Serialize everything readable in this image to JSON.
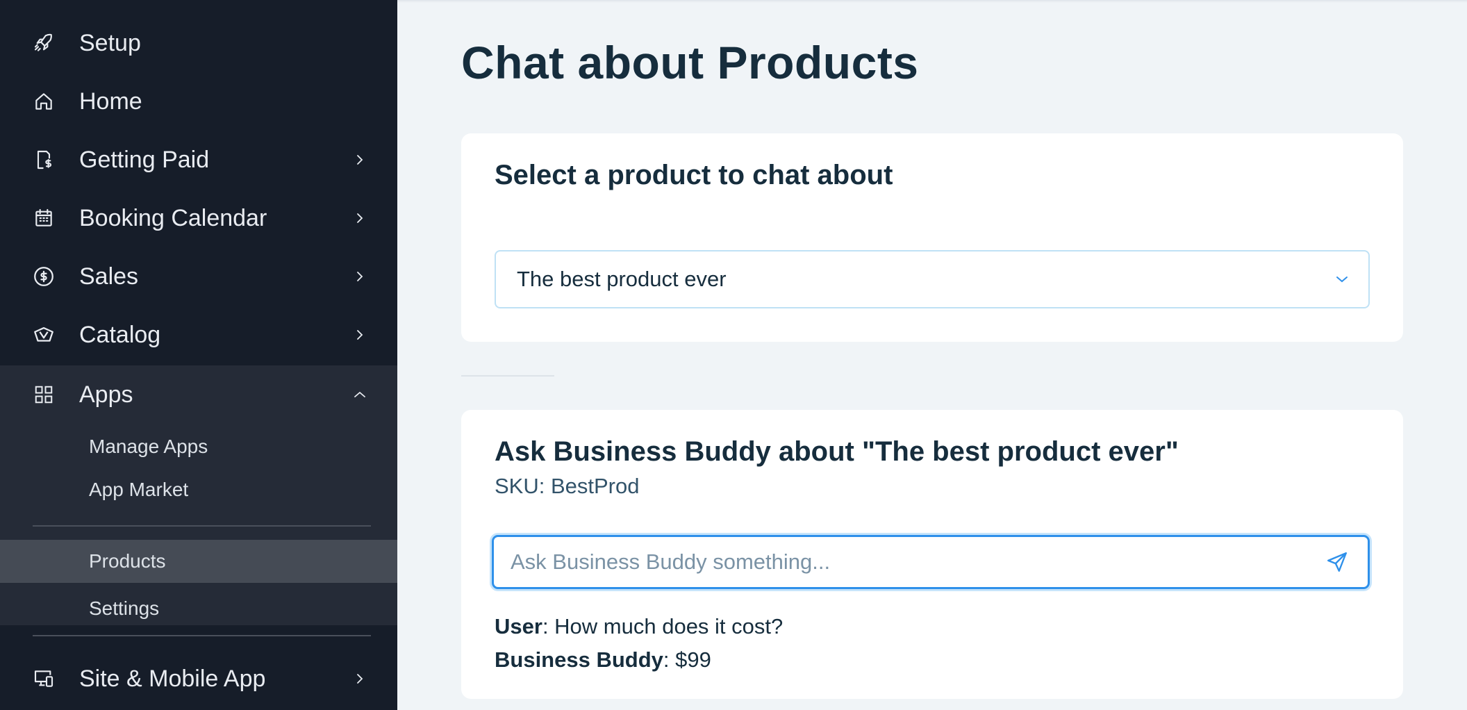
{
  "sidebar": {
    "items": [
      {
        "label": "Setup",
        "icon": "rocket-icon"
      },
      {
        "label": "Home",
        "icon": "home-icon"
      },
      {
        "label": "Getting Paid",
        "icon": "invoice-dollar-icon"
      },
      {
        "label": "Booking Calendar",
        "icon": "calendar-icon"
      },
      {
        "label": "Sales",
        "icon": "dollar-circle-icon"
      },
      {
        "label": "Catalog",
        "icon": "catalog-icon"
      },
      {
        "label": "Apps",
        "icon": "apps-icon"
      },
      {
        "label": "Site & Mobile App",
        "icon": "devices-icon"
      }
    ],
    "apps_sub": [
      {
        "label": "Manage Apps"
      },
      {
        "label": "App Market"
      }
    ],
    "apps_pages": [
      {
        "label": "Products",
        "active": true
      },
      {
        "label": "Settings",
        "active": false
      }
    ]
  },
  "main": {
    "title": "Chat about Products",
    "selector": {
      "title": "Select a product to chat about",
      "selected": "The best product ever"
    },
    "chat": {
      "title": "Ask Business Buddy about \"The best product ever\"",
      "sku": "SKU: BestProd",
      "placeholder": "Ask Business Buddy something...",
      "messages": [
        {
          "sender": "User",
          "text": ": How much does it cost?"
        },
        {
          "sender": "Business Buddy",
          "text": ": $99"
        }
      ]
    }
  },
  "colors": {
    "sidebar_bg": "#161d29",
    "apps_panel_bg": "#252b37",
    "active_item_bg": "#454b55",
    "page_bg": "#f0f4f7",
    "accent": "#2e90ea",
    "title_text": "#162d3d"
  }
}
